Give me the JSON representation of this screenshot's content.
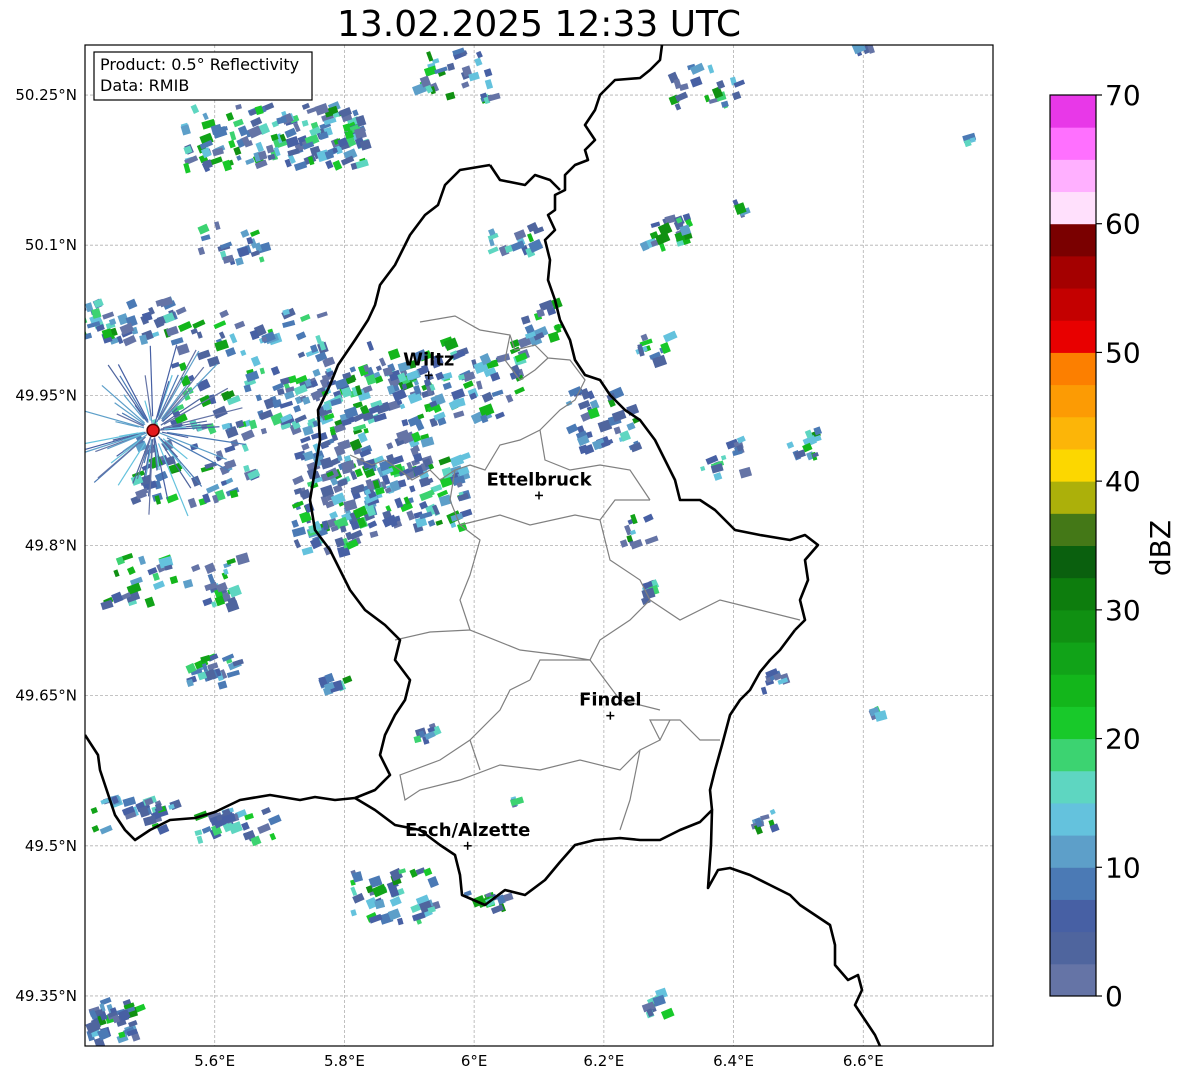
{
  "title": "13.02.2025 12:33 UTC",
  "info_box": {
    "line1": "Product: 0.5° Reflectivity",
    "line2": "Data: RMIB"
  },
  "map": {
    "lon_ticks": [
      {
        "value": 5.6,
        "label": "5.6°E"
      },
      {
        "value": 5.8,
        "label": "5.8°E"
      },
      {
        "value": 6.0,
        "label": "6°E"
      },
      {
        "value": 6.2,
        "label": "6.2°E"
      },
      {
        "value": 6.4,
        "label": "6.4°E"
      },
      {
        "value": 6.6,
        "label": "6.6°E"
      }
    ],
    "lat_ticks": [
      {
        "value": 50.25,
        "label": "50.25°N"
      },
      {
        "value": 50.1,
        "label": "50.1°N"
      },
      {
        "value": 49.95,
        "label": "49.95°N"
      },
      {
        "value": 49.8,
        "label": "49.8°N"
      },
      {
        "value": 49.65,
        "label": "49.65°N"
      },
      {
        "value": 49.5,
        "label": "49.5°N"
      },
      {
        "value": 49.35,
        "label": "49.35°N"
      }
    ],
    "extent": {
      "lon": [
        5.4,
        6.8
      ],
      "lat": [
        49.3,
        50.3
      ]
    },
    "grid": true,
    "cities": [
      {
        "name": "Wiltz",
        "lon": 5.93,
        "lat": 49.97
      },
      {
        "name": "Ettelbruck",
        "lon": 6.1,
        "lat": 49.85
      },
      {
        "name": "Findel",
        "lon": 6.21,
        "lat": 49.63
      },
      {
        "name": "Esch/Alzette",
        "lon": 5.99,
        "lat": 49.5
      }
    ],
    "radar_site": {
      "lon": 5.505,
      "lat": 49.915
    }
  },
  "colorbar": {
    "label": "dBZ",
    "tick_values": [
      0,
      10,
      20,
      30,
      40,
      50,
      60,
      70
    ],
    "tick_labels": [
      "0",
      "10",
      "20",
      "30",
      "40",
      "50",
      "60",
      "70"
    ],
    "colors": [
      "#6574a6",
      "#4f659e",
      "#4760a4",
      "#4b7ab5",
      "#5d9fc9",
      "#64c2dd",
      "#5ed6c1",
      "#3cd371",
      "#18c92a",
      "#13b61b",
      "#11a318",
      "#109012",
      "#0d7d0d",
      "#0a600e",
      "#447817",
      "#acb00a",
      "#fcd700",
      "#fcb508",
      "#fc9b04",
      "#fc7f00",
      "#e80000",
      "#c40000",
      "#a40000",
      "#7a0000",
      "#ffe0fc",
      "#ffb0ff",
      "#ff70ff",
      "#e838e8"
    ]
  },
  "colors": {
    "border": "#000000",
    "cantons": "#808080",
    "site": "#e31a1c"
  }
}
